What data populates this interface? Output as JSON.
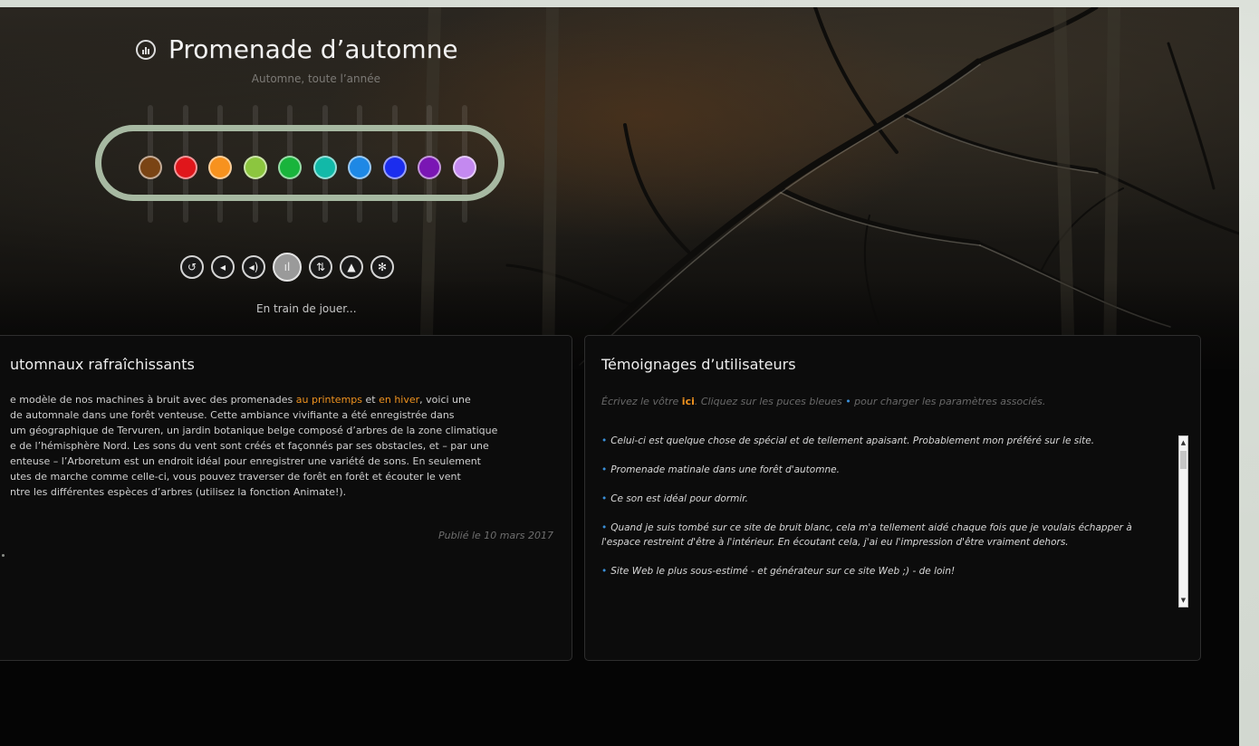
{
  "header": {
    "title": "Promenade d’automne",
    "subtitle": "Automne, toute l’année"
  },
  "sliders": [
    {
      "color": "#7a4414",
      "level": 0.47
    },
    {
      "color": "#e0161b",
      "level": 0.47
    },
    {
      "color": "#f7921e",
      "level": 0.47
    },
    {
      "color": "#8cc63f",
      "level": 0.47
    },
    {
      "color": "#19b43c",
      "level": 0.47
    },
    {
      "color": "#12b9a8",
      "level": 0.47
    },
    {
      "color": "#1e88e5",
      "level": 0.47
    },
    {
      "color": "#1b2dee",
      "level": 0.47
    },
    {
      "color": "#7a16b4",
      "level": 0.47
    },
    {
      "color": "#c489f0",
      "level": 0.47
    }
  ],
  "controls": [
    {
      "name": "reset-button",
      "icon": "undo-icon",
      "glyph": "↺"
    },
    {
      "name": "volume-down-button",
      "icon": "speaker-low-icon",
      "glyph": "◂"
    },
    {
      "name": "volume-up-button",
      "icon": "speaker-high-icon",
      "glyph": "◂)"
    },
    {
      "name": "play-button",
      "icon": "equalizer-icon",
      "glyph": "ıl"
    },
    {
      "name": "animate-button",
      "icon": "shuffle-icon",
      "glyph": "⇅"
    },
    {
      "name": "timer-button",
      "icon": "bell-icon",
      "glyph": "▲"
    },
    {
      "name": "settings-button",
      "icon": "gear-icon",
      "glyph": "✻"
    }
  ],
  "status": "En train de jouer...",
  "description_panel": {
    "title": "utomnaux rafraîchissants",
    "line1_pre": "e modèle de nos machines à bruit avec des promenades ",
    "line1_hl1": "au printemps",
    "line1_mid": " et ",
    "line1_hl2": "en hiver",
    "line1_post": ", voici une",
    "line2": "de automnale dans une forêt venteuse. Cette ambiance vivifiante a été enregistrée dans",
    "line3": "um géographique de Tervuren, un jardin botanique belge composé d’arbres de la zone climatique",
    "line4": "e de l’hémisphère Nord. Les sons du vent sont créés et façonnés par ses obstacles, et – par une",
    "line5": "enteuse – l’Arboretum est un endroit idéal pour enregistrer une variété de sons. En seulement",
    "line6": "utes de marche comme celle-ci, vous pouvez traverser de forêt en forêt et écouter le vent",
    "line7": "ntre les différentes espèces d’arbres (utilisez la fonction Animate!).",
    "published": "Publié le 10 mars 2017"
  },
  "testimonials_panel": {
    "title": "Témoignages d’utilisateurs",
    "invite_pre": "Écrivez le vôtre ",
    "invite_link": "ici",
    "invite_mid": ". Cliquez sur les puces bleues ",
    "invite_bullet": "•",
    "invite_post": " pour charger les paramètres associés.",
    "items": [
      "Celui-ci est quelque chose de spécial et de tellement apaisant. Probablement mon préféré sur le site.",
      "Promenade matinale dans une forêt d'automne.",
      "Ce son est idéal pour dormir.",
      "Quand je suis tombé sur ce site de bruit blanc, cela m'a tellement aidé chaque fois que je voulais échapper à l'espace restreint d'être à l'intérieur. En écoutant cela, j'ai eu l'impression d'être vraiment dehors.",
      "Site Web le plus sous-estimé - et générateur sur ce site Web ;) - de loin!"
    ]
  }
}
